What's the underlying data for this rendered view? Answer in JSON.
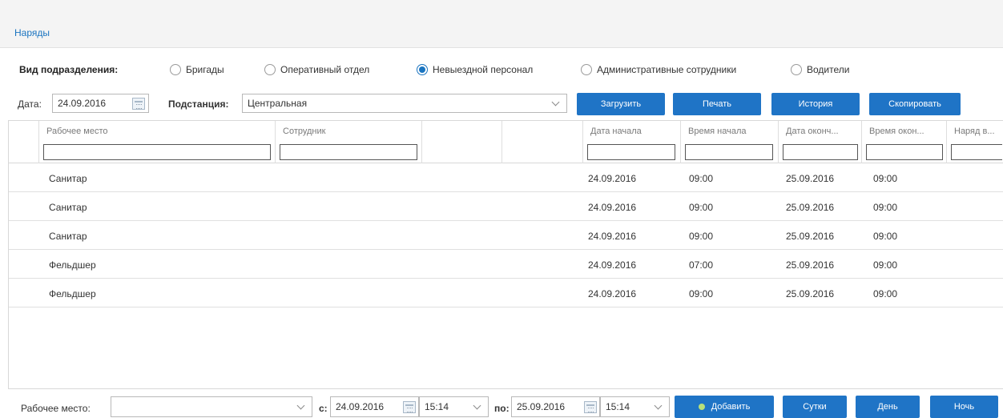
{
  "breadcrumb": "Наряды",
  "unit_type": {
    "label": "Вид подразделения:",
    "options": [
      {
        "label": "Бригады",
        "selected": false
      },
      {
        "label": "Оперативный отдел",
        "selected": false
      },
      {
        "label": "Невыездной персонал",
        "selected": true
      },
      {
        "label": "Административные сотрудники",
        "selected": false
      },
      {
        "label": "Водители",
        "selected": false
      }
    ]
  },
  "filters": {
    "date_label": "Дата:",
    "date_value": "24.09.2016",
    "substation_label": "Подстанция:",
    "substation_value": "Центральная"
  },
  "toolbar": {
    "load": "Загрузить",
    "print": "Печать",
    "history": "История",
    "copy": "Скопировать"
  },
  "table": {
    "columns": [
      "Рабочее место",
      "Сотрудник",
      "",
      "",
      "Дата начала",
      "Время начала",
      "Дата оконч...",
      "Время окон...",
      "Наряд в..."
    ],
    "rows": [
      {
        "workplace": "Санитар",
        "date_start": "24.09.2016",
        "time_start": "09:00",
        "date_end": "25.09.2016",
        "time_end": "09:00"
      },
      {
        "workplace": "Санитар",
        "date_start": "24.09.2016",
        "time_start": "09:00",
        "date_end": "25.09.2016",
        "time_end": "09:00"
      },
      {
        "workplace": "Санитар",
        "date_start": "24.09.2016",
        "time_start": "09:00",
        "date_end": "25.09.2016",
        "time_end": "09:00"
      },
      {
        "workplace": "Фельдшер",
        "date_start": "24.09.2016",
        "time_start": "07:00",
        "date_end": "25.09.2016",
        "time_end": "09:00"
      },
      {
        "workplace": "Фельдшер",
        "date_start": "24.09.2016",
        "time_start": "09:00",
        "date_end": "25.09.2016",
        "time_end": "09:00"
      }
    ]
  },
  "bottom": {
    "workplace_label": "Рабочее место:",
    "workplace_value": "",
    "from_label": "с:",
    "from_date": "24.09.2016",
    "from_time": "15:14",
    "to_label": "по:",
    "to_date": "25.09.2016",
    "to_time": "15:14",
    "add": "Добавить",
    "day24": "Сутки",
    "day": "День",
    "night": "Ночь"
  },
  "colors": {
    "accent": "#1f74c6",
    "link": "#1a74c0",
    "add_dot": "#b8e07a"
  }
}
